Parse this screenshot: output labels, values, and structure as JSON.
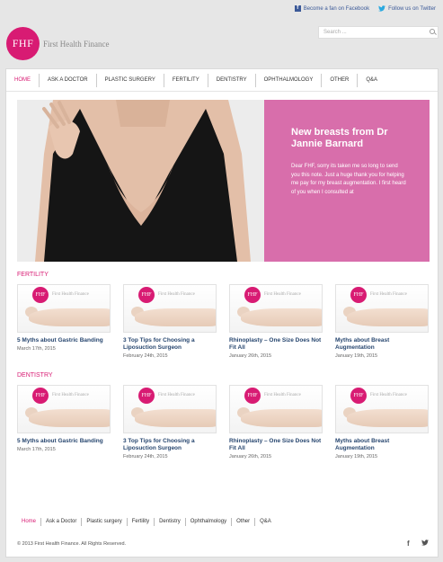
{
  "topbar": {
    "facebook_label": "Become a fan on Facebook",
    "twitter_label": "Follow us on Twitter"
  },
  "logo": {
    "mark": "FHF",
    "name": "First Health Finance"
  },
  "search": {
    "placeholder": "Search ..."
  },
  "nav": {
    "items": [
      {
        "label": "HOME",
        "active": true
      },
      {
        "label": "ASK A DOCTOR"
      },
      {
        "label": "PLASTIC SURGERY"
      },
      {
        "label": "FERTILITY"
      },
      {
        "label": "DENTISTRY"
      },
      {
        "label": "OPHTHALMOLOGY"
      },
      {
        "label": "OTHER"
      },
      {
        "label": "Q&A"
      }
    ]
  },
  "hero": {
    "title": "New breasts from Dr Jannie Barnard",
    "body": "Dear FHF, sorry its taken me so long to send you this note. Just a huge thank you for helping me pay for my breast augmentation. I first heard of you when I consulted at"
  },
  "sections": [
    {
      "title": "FERTILITY",
      "posts": [
        {
          "title": "5 Myths about Gastric Banding",
          "date": "March 17th, 2015",
          "thumb_mark": "FHF",
          "thumb_name": "First Health Finance"
        },
        {
          "title": "3 Top Tips for Choosing a Liposuction Surgeon",
          "date": "February 24th, 2015",
          "thumb_mark": "FHF",
          "thumb_name": "First Health Finance"
        },
        {
          "title": "Rhinoplasty – One Size Does Not Fit All",
          "date": "January 26th, 2015",
          "thumb_mark": "FHF",
          "thumb_name": "First Health Finance"
        },
        {
          "title": "Myths about Breast Augmentation",
          "date": "January 19th, 2015",
          "thumb_mark": "FHF",
          "thumb_name": "First Health Finance"
        }
      ]
    },
    {
      "title": "DENTISTRY",
      "posts": [
        {
          "title": "5 Myths about Gastric Banding",
          "date": "March 17th, 2015",
          "thumb_mark": "FHF",
          "thumb_name": "First Health Finance"
        },
        {
          "title": "3 Top Tips for Choosing a Liposuction Surgeon",
          "date": "February 24th, 2015",
          "thumb_mark": "FHF",
          "thumb_name": "First Health Finance"
        },
        {
          "title": "Rhinoplasty – One Size Does Not Fit All",
          "date": "January 26th, 2015",
          "thumb_mark": "FHF",
          "thumb_name": "First Health Finance"
        },
        {
          "title": "Myths about Breast Augmentation",
          "date": "January 19th, 2015",
          "thumb_mark": "FHF",
          "thumb_name": "First Health Finance"
        }
      ]
    }
  ],
  "footer": {
    "links": [
      {
        "label": "Home",
        "active": true
      },
      {
        "label": "Ask a Doctor"
      },
      {
        "label": "Plastic surgery"
      },
      {
        "label": "Fertility"
      },
      {
        "label": "Dentistry"
      },
      {
        "label": "Ophthalmology"
      },
      {
        "label": "Other"
      },
      {
        "label": "Q&A"
      }
    ],
    "copyright": "© 2013 First Health Finance. All Rights Reserved.",
    "facebook_icon": "f",
    "twitter_icon": "t"
  },
  "colors": {
    "brand": "#d81b73",
    "hero_panel": "#d86eab",
    "link": "#27466f"
  }
}
